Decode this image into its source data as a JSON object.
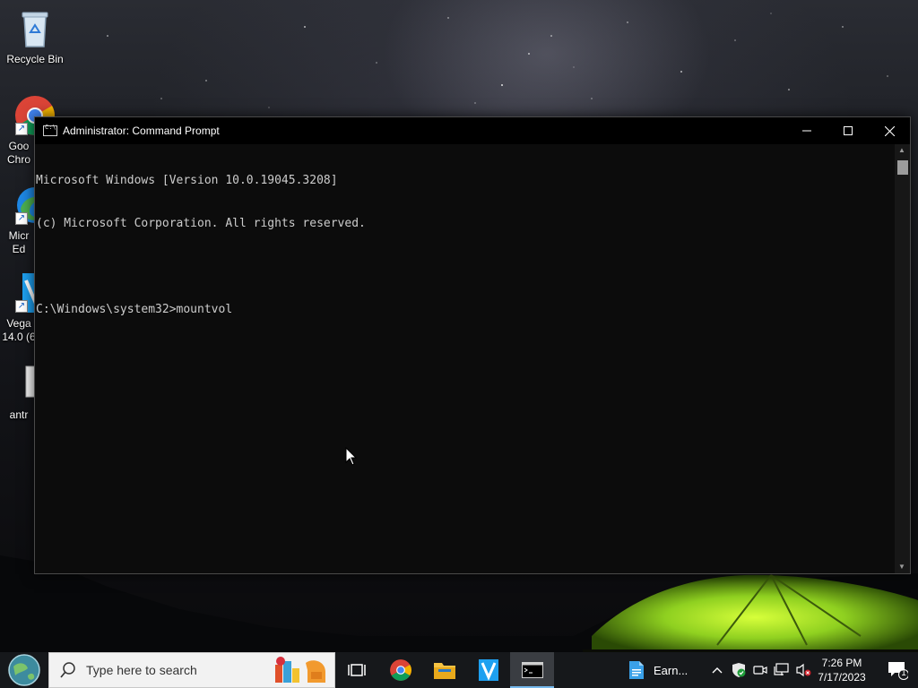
{
  "desktop": {
    "icons": [
      {
        "id": "recycle-bin",
        "label": "Recycle Bin"
      },
      {
        "id": "chrome",
        "label": "Goo Chro"
      },
      {
        "id": "edge",
        "label": "Micr Ed"
      },
      {
        "id": "vegas",
        "label": "Vega 14.0 (6"
      },
      {
        "id": "antr",
        "label": "antr"
      }
    ]
  },
  "window": {
    "title": "Administrator: Command Prompt",
    "controls": {
      "minimize": "minimize",
      "maximize": "maximize",
      "close": "close"
    },
    "console_lines": [
      "Microsoft Windows [Version 10.0.19045.3208]",
      "(c) Microsoft Corporation. All rights reserved.",
      "",
      "C:\\Windows\\system32>mountvol"
    ]
  },
  "taskbar": {
    "search_placeholder": "Type here to search",
    "earn_label": "Earn...",
    "clock": {
      "time": "7:26 PM",
      "date": "7/17/2023"
    },
    "notification_count": "1",
    "accent_color": "#76b9ed"
  }
}
